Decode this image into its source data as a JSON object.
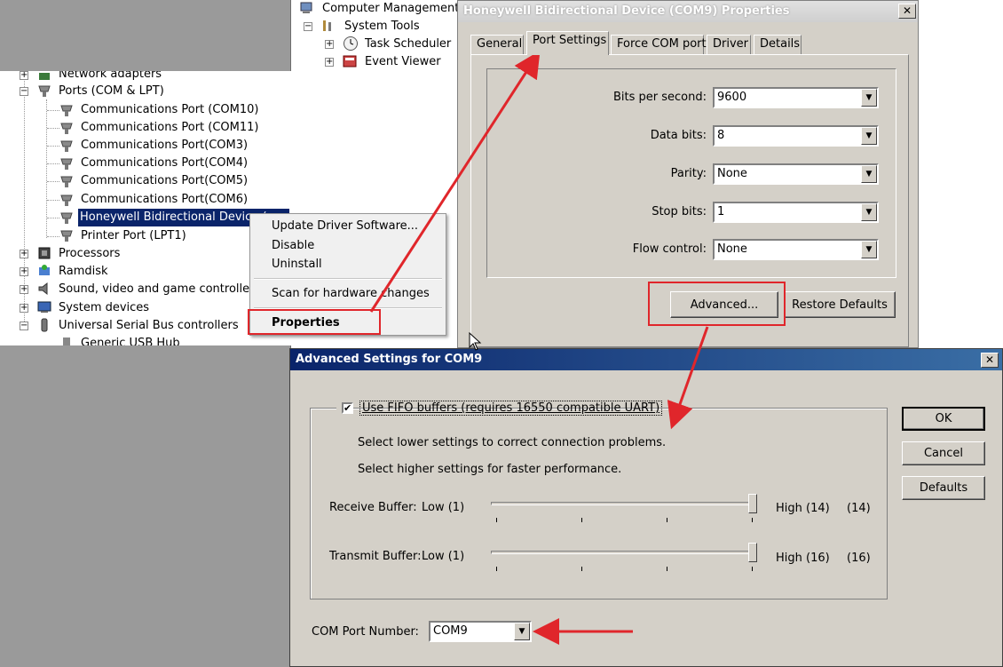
{
  "computer_management": {
    "title": "Computer Management (",
    "system_tools": "System Tools",
    "task_scheduler": "Task Scheduler",
    "event_viewer": "Event Viewer"
  },
  "device_tree": {
    "network_adapters": "Network adapters",
    "ports": "Ports (COM & LPT)",
    "port_items": [
      "Communications Port (COM10)",
      "Communications Port (COM11)",
      "Communications Port(COM3)",
      "Communications Port(COM4)",
      "Communications Port(COM5)",
      "Communications Port(COM6)"
    ],
    "selected_device": "Honeywell Bidirectional Device (",
    "printer_port": "Printer Port (LPT1)",
    "categories": [
      "Processors",
      "Ramdisk",
      "Sound, video and game controllers",
      "System devices",
      "Universal Serial Bus controllers"
    ],
    "generic_usb": "Generic USB Hub"
  },
  "context_menu": {
    "update_driver": "Update Driver Software...",
    "disable": "Disable",
    "uninstall": "Uninstall",
    "scan": "Scan for hardware changes",
    "properties": "Properties"
  },
  "properties_dialog": {
    "title": "Honeywell Bidirectional Device (COM9) Properties",
    "close": "✕",
    "tabs": [
      "General",
      "Port Settings",
      "Force COM port",
      "Driver",
      "Details"
    ],
    "active_tab": "Port Settings",
    "fields": {
      "bits_per_second": {
        "label": "Bits per second:",
        "value": "9600"
      },
      "data_bits": {
        "label": "Data bits:",
        "value": "8"
      },
      "parity": {
        "label": "Parity:",
        "value": "None"
      },
      "stop_bits": {
        "label": "Stop bits:",
        "value": "1"
      },
      "flow_control": {
        "label": "Flow control:",
        "value": "None"
      }
    },
    "advanced_button": "Advanced...",
    "restore_defaults_button": "Restore Defaults"
  },
  "advanced_dialog": {
    "title": "Advanced Settings for COM9",
    "close": "✕",
    "fifo_label": "Use FIFO buffers (requires 16550 compatible UART)",
    "fifo_checked": true,
    "hint_lower": "Select lower settings to correct connection problems.",
    "hint_higher": "Select higher settings for faster performance.",
    "receive_buffer": {
      "label": "Receive Buffer:",
      "low": "Low (1)",
      "high": "High (14)",
      "value": "(14)",
      "level": 1.0
    },
    "transmit_buffer": {
      "label": "Transmit Buffer:",
      "low": "Low (1)",
      "high": "High (16)",
      "value": "(16)",
      "level": 1.0
    },
    "com_port_label": "COM Port Number:",
    "com_port_value": "COM9",
    "ok_button": "OK",
    "cancel_button": "Cancel",
    "defaults_button": "Defaults"
  },
  "colors": {
    "annotation_red": "#e0262b",
    "selection_blue": "#0a246a",
    "dialog_face": "#d4d0c8"
  }
}
